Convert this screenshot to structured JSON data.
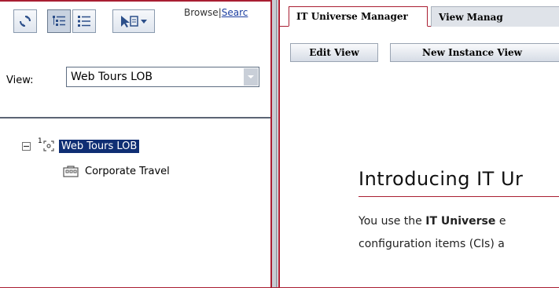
{
  "toolbar": {
    "refresh_icon": "refresh-icon",
    "tree_view_icon": "tree-view-icon",
    "list_view_icon": "list-view-icon",
    "view_actions_icon": "view-actions-icon",
    "browse_label": "Browse",
    "separator": "|",
    "search_label": "Searc"
  },
  "view_selector": {
    "label": "View:",
    "value": "Web Tours LOB"
  },
  "tree": {
    "root": {
      "toggle": "⊟",
      "level": "1",
      "label": "Web Tours LOB",
      "icon": "business-view-icon"
    },
    "children": [
      {
        "label": "Corporate Travel",
        "icon": "business-unit-icon"
      }
    ]
  },
  "tabs": [
    {
      "label": "IT Universe Manager",
      "active": true
    },
    {
      "label": "View Manag",
      "active": false
    }
  ],
  "actions": {
    "edit_view": "Edit View",
    "new_instance_view": "New Instance View"
  },
  "content": {
    "title": "Introducing IT Ur",
    "line1_prefix": "You use the ",
    "line1_bold": "IT Universe",
    "line1_suffix": " e",
    "line2": "configuration items (CIs) a"
  },
  "colors": {
    "accent": "#a91e32",
    "selection": "#0f2e73",
    "link": "#1b3ea0"
  }
}
